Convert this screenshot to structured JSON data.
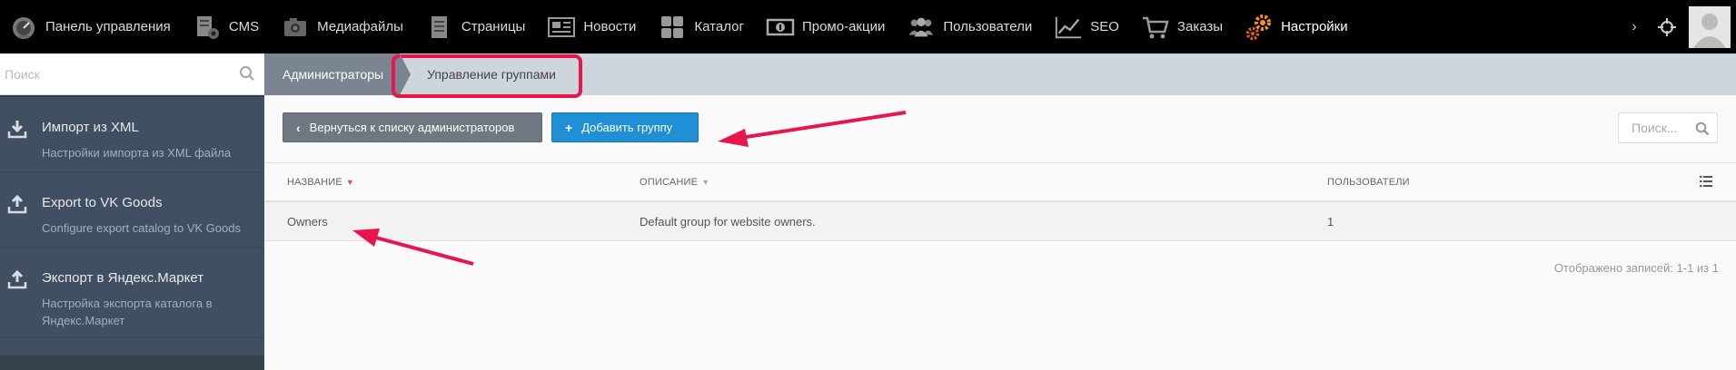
{
  "nav": {
    "items": [
      {
        "label": "Панель управления",
        "icon": "speedometer-icon"
      },
      {
        "label": "CMS",
        "icon": "cms-icon"
      },
      {
        "label": "Медиафайлы",
        "icon": "camera-icon"
      },
      {
        "label": "Страницы",
        "icon": "pages-icon"
      },
      {
        "label": "Новости",
        "icon": "newspaper-icon"
      },
      {
        "label": "Каталог",
        "icon": "grid-icon"
      },
      {
        "label": "Промо-акции",
        "icon": "banknote-icon"
      },
      {
        "label": "Пользователи",
        "icon": "users-icon"
      },
      {
        "label": "SEO",
        "icon": "chart-line-icon"
      },
      {
        "label": "Заказы",
        "icon": "cart-icon"
      },
      {
        "label": "Настройки",
        "icon": "gears-icon"
      }
    ],
    "active_color": "#f7931e"
  },
  "sidebar": {
    "search_placeholder": "Поиск",
    "items": [
      {
        "title": "Импорт из XML",
        "desc": "Настройки импорта из XML файла",
        "icon": "download-icon"
      },
      {
        "title": "Export to VK Goods",
        "desc": "Configure export catalog to VK Goods",
        "icon": "upload-icon"
      },
      {
        "title": "Экспорт в Яндекс.Маркет",
        "desc": "Настройка экспорта каталога в Яндекс.Маркет",
        "icon": "upload-icon"
      }
    ]
  },
  "breadcrumb": {
    "parent": "Администраторы",
    "current": "Управление группами"
  },
  "toolbar": {
    "back_label": "Вернуться к списку администраторов",
    "add_label": "Добавить группу",
    "search_placeholder": "Поиск..."
  },
  "table": {
    "columns": [
      "НАЗВАНИЕ",
      "ОПИСАНИЕ",
      "ПОЛЬЗОВАТЕЛИ"
    ],
    "rows": [
      {
        "name": "Owners",
        "description": "Default group for website owners.",
        "users": "1"
      }
    ],
    "footer": "Отображено записей: 1-1 из 1"
  },
  "colors": {
    "highlight": "#e8164d",
    "add_button": "#1f8fd6",
    "back_button": "#6f7780"
  }
}
